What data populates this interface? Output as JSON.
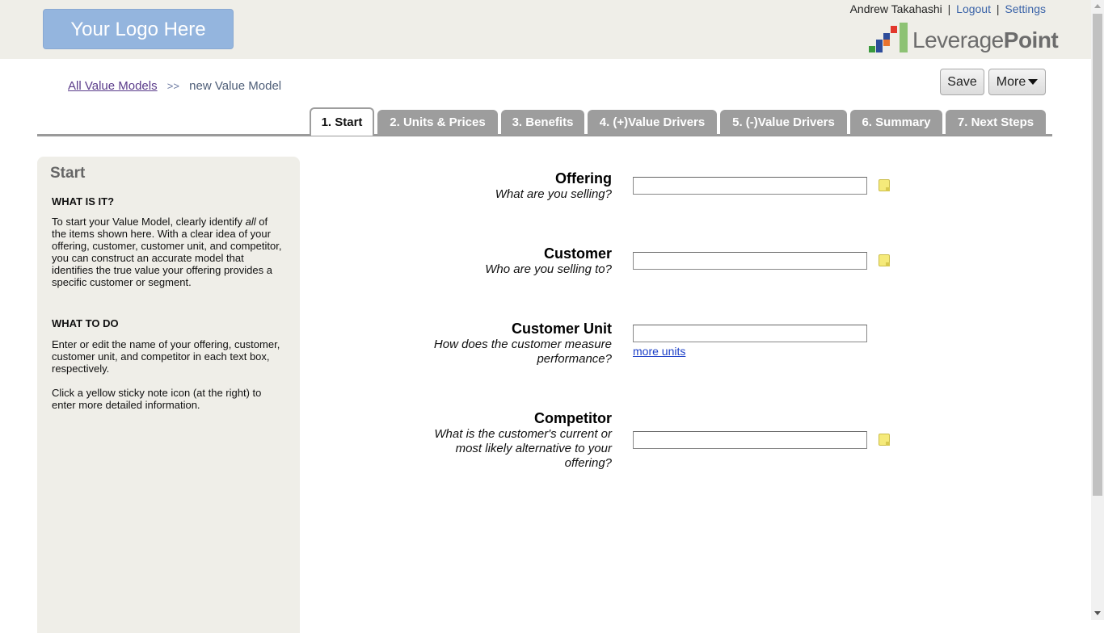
{
  "header": {
    "logo_text": "Your Logo Here",
    "user_name": "Andrew Takahashi",
    "logout_label": "Logout",
    "settings_label": "Settings",
    "separator": "|",
    "brand_left": "Leverage",
    "brand_right": "Point"
  },
  "breadcrumb": {
    "parent_label": "All Value Models",
    "separator": ">>",
    "current_label": "new Value Model"
  },
  "toolbar": {
    "save_label": "Save",
    "more_label": "More"
  },
  "tabs": [
    {
      "label": "1. Start",
      "active": true
    },
    {
      "label": "2. Units & Prices",
      "active": false
    },
    {
      "label": "3. Benefits",
      "active": false
    },
    {
      "label": "4. (+)Value Drivers",
      "active": false
    },
    {
      "label": "5. (-)Value Drivers",
      "active": false
    },
    {
      "label": "6. Summary",
      "active": false
    },
    {
      "label": "7. Next Steps",
      "active": false
    }
  ],
  "sidebar": {
    "title": "Start",
    "what_heading": "WHAT IS IT?",
    "what_text_1": "To start your Value Model, clearly identify ",
    "what_text_em": "all",
    "what_text_2": " of the items shown here. With a clear idea of your offering, customer, customer unit, and competitor, you can construct an accurate model that identifies the true value your offering provides a specific customer or segment.",
    "todo_heading": "WHAT TO DO",
    "todo_text_1": "Enter or edit the name of your offering, customer, customer unit, and competitor in each text box, respectively.",
    "todo_text_2": "Click a yellow sticky note icon (at the right) to enter more detailed information."
  },
  "form": {
    "offering": {
      "label": "Offering",
      "question": "What are you selling?",
      "value": ""
    },
    "customer": {
      "label": "Customer",
      "question": "Who are you selling to?",
      "value": ""
    },
    "customer_unit": {
      "label": "Customer Unit",
      "question_1": "How does the customer measure",
      "question_2": "performance?",
      "value": "",
      "more_link": "more units"
    },
    "competitor": {
      "label": "Competitor",
      "question_1": "What is the customer's current or",
      "question_2": "most likely alternative to your",
      "question_3": "offering?",
      "value": ""
    }
  },
  "colors": {
    "header_bg": "#efeee8",
    "tab_bg": "#9d9d9d",
    "logo_bg": "#94b5de",
    "link": "#3a63a8",
    "sticky_note": "#f5ea7a"
  }
}
